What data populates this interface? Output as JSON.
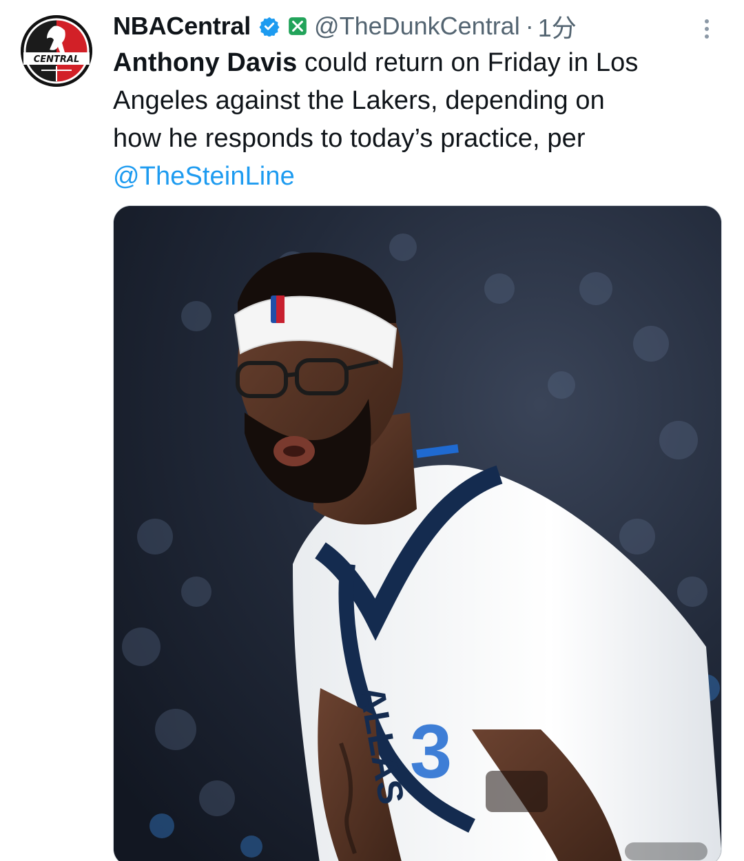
{
  "author": {
    "display_name": "NBACentral",
    "handle": "@TheDunkCentral",
    "separator": "·",
    "time": "1分",
    "avatar_text": "CENTRAL"
  },
  "tweet": {
    "line1_bold": "Anthony Davis",
    "line1_rest": " could return on Friday in Los",
    "line2": "Angeles against the Lakers, depending on",
    "line3": "how he responds to today’s practice, per",
    "mention": "@TheSteinLine"
  },
  "media": {
    "jersey_text": "ALLAS",
    "jersey_number": "3"
  },
  "colors": {
    "link": "#1d9bf0",
    "secondary_text": "#536471",
    "primary_text": "#0f1419",
    "verified": "#1d9bf0",
    "x_badge": "#22a35a"
  },
  "icons": {
    "verified": "verified-badge-icon",
    "x_badge": "x-logo-icon",
    "more": "more-options-icon"
  }
}
